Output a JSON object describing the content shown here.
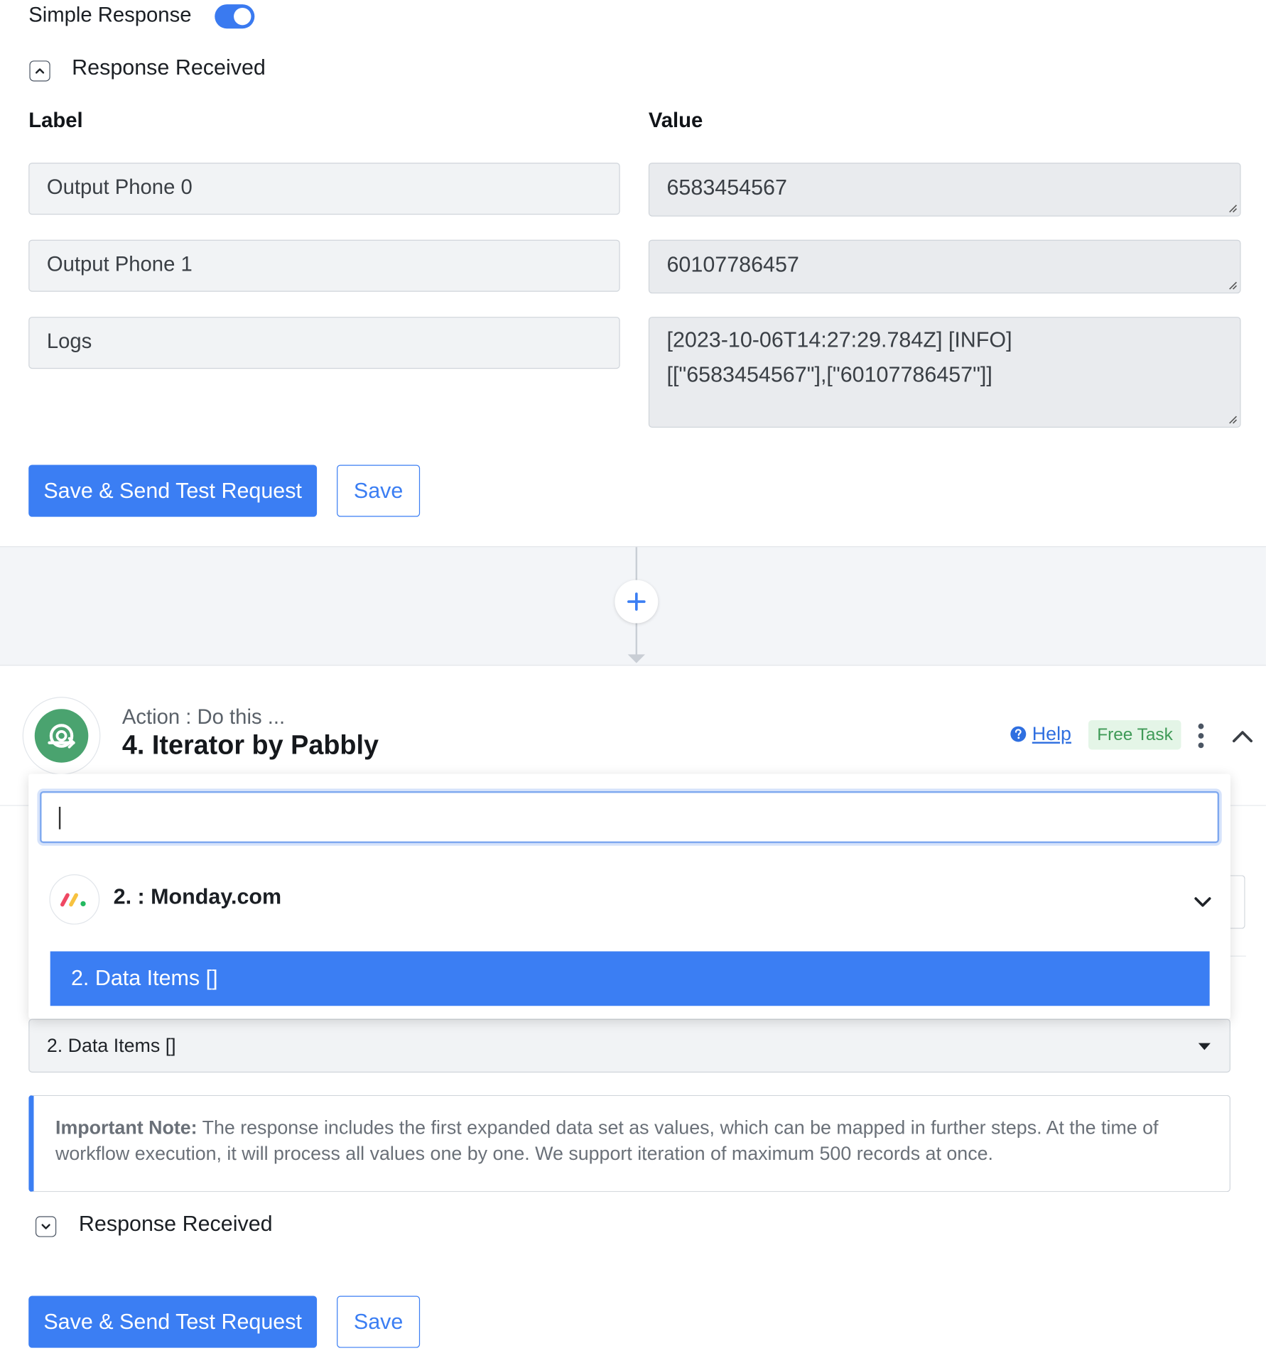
{
  "top": {
    "simple_response_label": "Simple Response",
    "simple_response_on": true,
    "response_received_label": "Response Received",
    "label_header": "Label",
    "value_header": "Value",
    "rows": [
      {
        "label": "Output Phone 0",
        "value": "6583454567"
      },
      {
        "label": "Output Phone 1",
        "value": "60107786457"
      },
      {
        "label": "Logs",
        "value_line1": "[2023-10-06T14:27:29.784Z]  [INFO]",
        "value_line2": "[[\"6583454567\"],[\"60107786457\"]]"
      }
    ],
    "save_send_label": "Save & Send Test Request",
    "save_label": "Save"
  },
  "action": {
    "subtitle": "Action : Do this ...",
    "title": "4. Iterator by Pabbly",
    "help_label": "Help",
    "badge": "Free Task",
    "app_icon": "iterator-icon",
    "accent_color": "#4aa36f"
  },
  "dropdown": {
    "search_value": "",
    "group_name": "2. : Monday.com",
    "group_icon": "monday-logo",
    "selected_option": "2. Data Items []"
  },
  "form": {
    "select_value": "2. Data Items []",
    "note_bold": "Important Note:",
    "note_text": " The response includes the first expanded data set as values, which can be mapped in further steps. At the time of workflow execution, it will process all values one by one. We support iteration of maximum 500 records at once.",
    "response_received_label": "Response Received",
    "save_send_label": "Save & Send Test Request",
    "save_label": "Save"
  },
  "colors": {
    "primary": "#3b7ef3",
    "badge_bg": "#e4f5e7",
    "badge_text": "#3f9a57"
  }
}
